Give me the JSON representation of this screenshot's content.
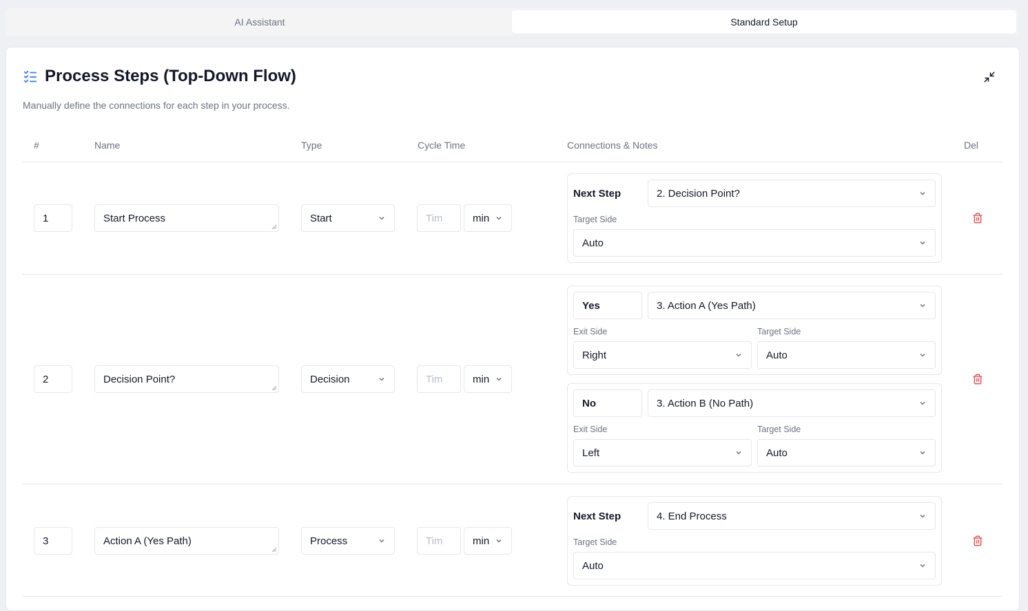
{
  "tabs": [
    "AI Assistant",
    "Standard Setup"
  ],
  "card": {
    "title": "Process Steps (Top-Down Flow)",
    "subtitle": "Manually define the connections for each step in your process.",
    "title_icon": "checklist-icon",
    "collapse_icon": "minimize-icon"
  },
  "table": {
    "headers": {
      "num": "#",
      "name": "Name",
      "type": "Type",
      "cycle": "Cycle Time",
      "connections": "Connections & Notes",
      "del": "Del"
    },
    "time_placeholder": "Tim",
    "rows": [
      {
        "num": "1",
        "name": "Start Process",
        "type": "Start",
        "time_value": "",
        "time_unit": "min",
        "connections": [
          {
            "label": "Next Step",
            "target": "2. Decision Point?",
            "target_side_label": "Target Side",
            "target_side": "Auto"
          }
        ]
      },
      {
        "num": "2",
        "name": "Decision Point?",
        "type": "Decision",
        "time_value": "",
        "time_unit": "min",
        "connections": [
          {
            "label": "Yes",
            "target": "3. Action A (Yes Path)",
            "exit_side_label": "Exit Side",
            "exit_side": "Right",
            "target_side_label": "Target Side",
            "target_side": "Auto"
          },
          {
            "label": "No",
            "target": "3. Action B (No Path)",
            "exit_side_label": "Exit Side",
            "exit_side": "Left",
            "target_side_label": "Target Side",
            "target_side": "Auto"
          }
        ]
      },
      {
        "num": "3",
        "name": "Action A (Yes Path)",
        "type": "Process",
        "time_value": "",
        "time_unit": "min",
        "connections": [
          {
            "label": "Next Step",
            "target": "4. End Process",
            "target_side_label": "Target Side",
            "target_side": "Auto"
          }
        ]
      }
    ]
  },
  "colors": {
    "accent": "#3b82f6",
    "danger": "#ef4444",
    "border": "#e5e7eb",
    "muted": "#6b7280"
  }
}
